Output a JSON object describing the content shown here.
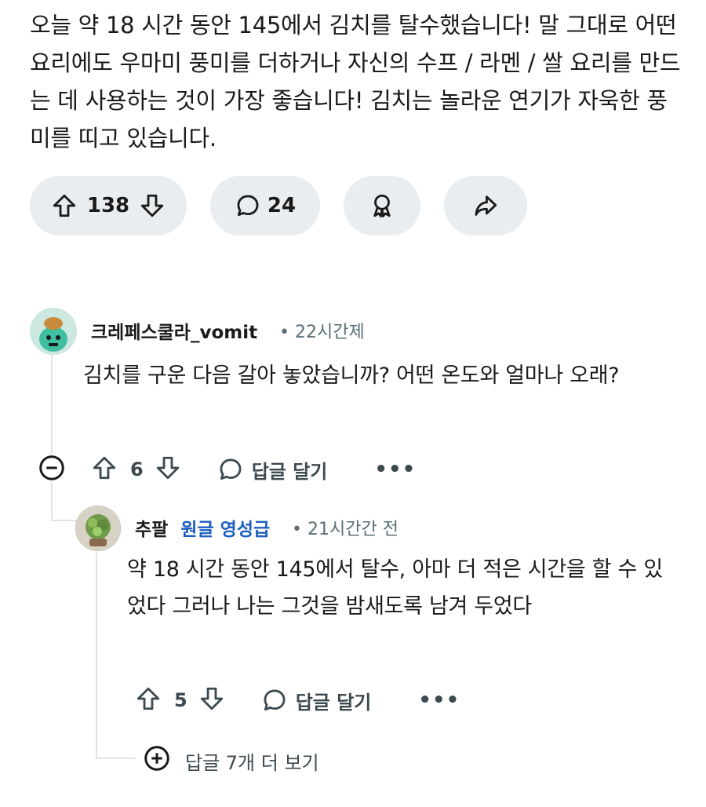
{
  "post": {
    "body": "오늘 약 18 시간 동안 145에서 김치를 탈수했습니다! 말 그대로 어떤 요리에도 우마미 풍미를 더하거나 자신의 수프 / 라멘 / 쌀 요리를 만드는 데 사용하는 것이 가장 좋습니다! 김치는 놀라운 연기가 자욱한 풍미를 띠고 있습니다."
  },
  "actions": {
    "upvote_icon": "upvote-icon",
    "vote_count": "138",
    "downvote_icon": "downvote-icon",
    "comment_icon": "comment-icon",
    "comment_count": "24",
    "award_icon": "award-icon",
    "share_icon": "share-icon"
  },
  "comments": [
    {
      "username": "크레페스쿨라_vomit",
      "time": "22시간제",
      "body": "김치를 구운 다음 갈아 놓았습니까? 어떤 온도와 얼마나 오래?",
      "votes": "6",
      "reply_label": "답글 달기",
      "more_label": "•••"
    },
    {
      "username": "추팔",
      "flair": "원글 영성급",
      "time": "21시간간 전",
      "body": "약 18 시간 동안 145에서 탈수, 아마 더 적은 시간을 할 수 있었다 그러나 나는 그것을 밤새도록 남겨 두었다",
      "votes": "5",
      "reply_label": "답글 달기",
      "more_label": "•••"
    }
  ],
  "more_replies": {
    "label": "답글 7개 더 보기",
    "icon": "plus-circle-icon"
  }
}
